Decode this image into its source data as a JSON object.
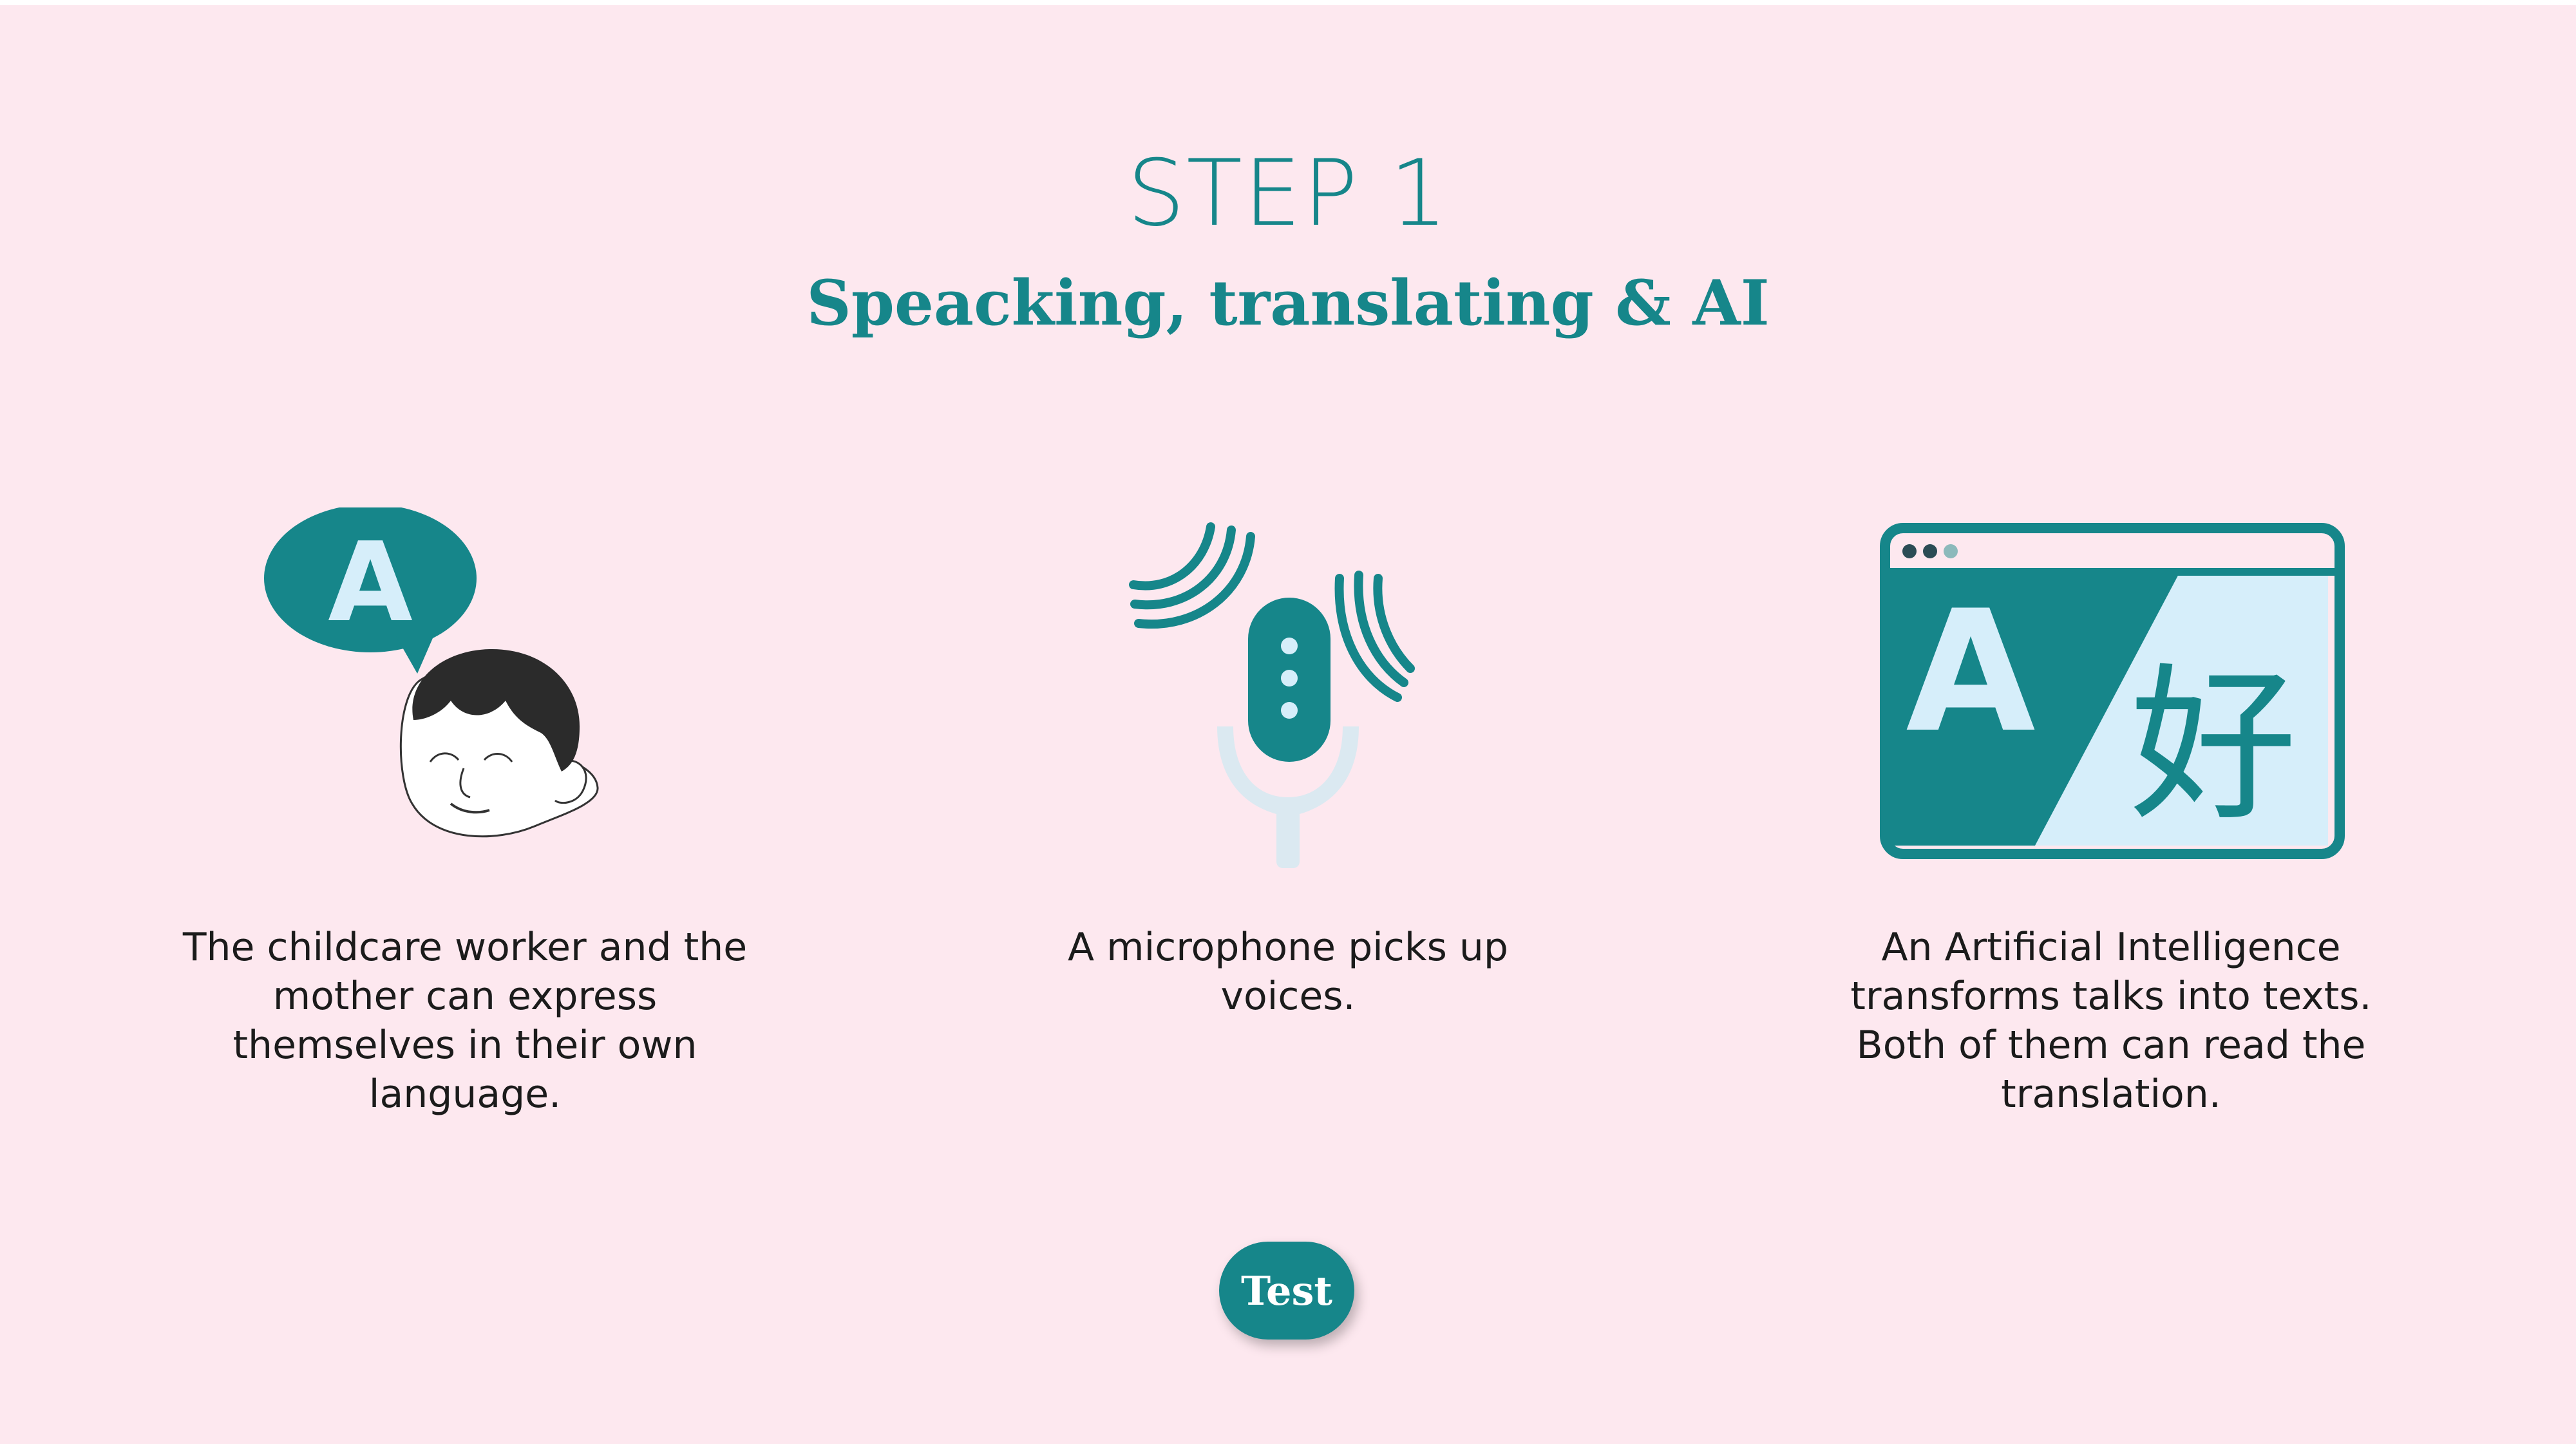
{
  "slide": {
    "step_title": "STEP 1",
    "subtitle": "Speacking, translating & AI"
  },
  "columns": [
    {
      "icon": "speaking-child-icon",
      "bubble_letter": "A",
      "description": "The childcare worker and the mother can express themselves in their own language."
    },
    {
      "icon": "microphone-icon",
      "description": "A microphone picks up voices."
    },
    {
      "icon": "translation-window-icon",
      "source_letter": "A",
      "target_glyph": "好",
      "description": "An Artificial Intelligence transforms talks into texts. Both of them can read the translation."
    }
  ],
  "test_button": {
    "label": "Test"
  },
  "colors": {
    "background": "#fde8ef",
    "accent": "#16868a",
    "light_blue": "#d6eefa",
    "mic_stand": "#dbe9f1",
    "hair": "#2b2b2b"
  }
}
